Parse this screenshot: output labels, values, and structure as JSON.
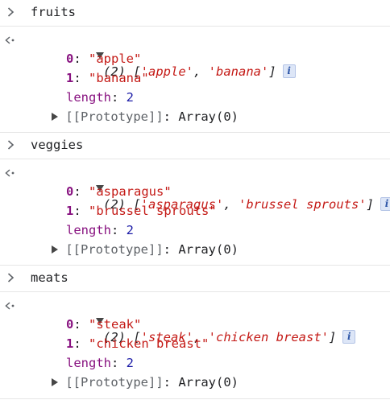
{
  "entries": [
    {
      "input": "fruits",
      "summary_count": "(2)",
      "items": [
        "'apple'",
        "'banana'"
      ],
      "expanded": [
        {
          "index": "0",
          "value": "\"apple\""
        },
        {
          "index": "1",
          "value": "\"banana\""
        }
      ],
      "length_key": "length",
      "length_value": "2",
      "prototype_key": "[[Prototype]]",
      "prototype_value": "Array(0)"
    },
    {
      "input": "veggies",
      "summary_count": "(2)",
      "items": [
        "'asparagus'",
        "'brussel sprouts'"
      ],
      "expanded": [
        {
          "index": "0",
          "value": "\"asparagus\""
        },
        {
          "index": "1",
          "value": "\"brussel sprouts\""
        }
      ],
      "length_key": "length",
      "length_value": "2",
      "prototype_key": "[[Prototype]]",
      "prototype_value": "Array(0)"
    },
    {
      "input": "meats",
      "summary_count": "(2)",
      "items": [
        "'steak'",
        "'chicken breast'"
      ],
      "expanded": [
        {
          "index": "0",
          "value": "\"steak\""
        },
        {
          "index": "1",
          "value": "\"chicken breast\""
        }
      ],
      "length_key": "length",
      "length_value": "2",
      "prototype_key": "[[Prototype]]",
      "prototype_value": "Array(0)"
    }
  ],
  "info_badge": "i",
  "icons": {
    "prompt": "chevron-right-icon",
    "return": "return-arrow-icon",
    "expand": "triangle-down-icon",
    "collapse": "triangle-right-icon"
  },
  "colors": {
    "string": "#c41a16",
    "key": "#881280",
    "number": "#1a1aa6",
    "info_bg": "#dde6f7"
  }
}
